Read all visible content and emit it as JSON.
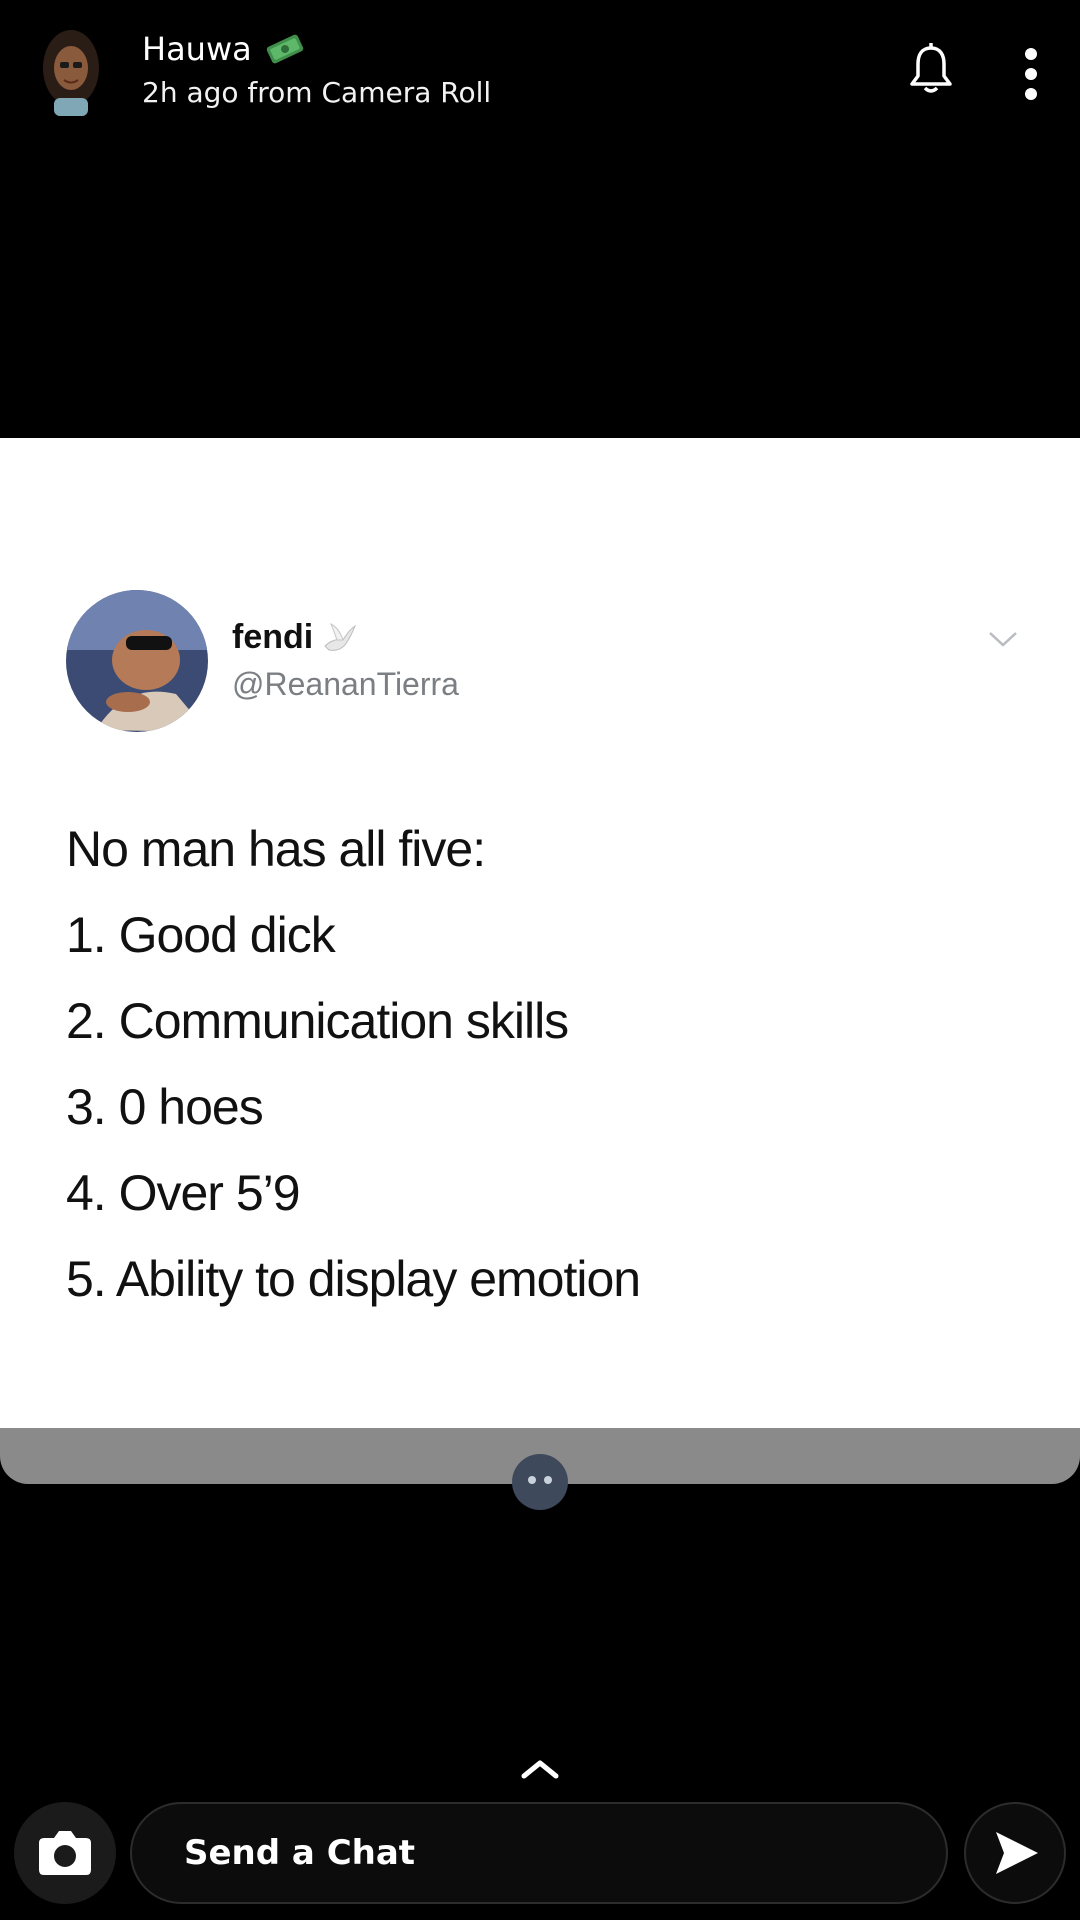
{
  "header": {
    "username": "Hauwa",
    "subtitle": "2h ago from Camera Roll",
    "icons": [
      "avatar",
      "money-icon",
      "bell-icon",
      "more-icon"
    ]
  },
  "tweet": {
    "display_name": "fendi",
    "handle": "@ReananTierra",
    "lines": [
      "No man has all five:",
      "1. Good dick",
      "2. Communication skills",
      "3. 0 hoes",
      "4. Over 5’9",
      "5. Ability to display emotion"
    ]
  },
  "composer": {
    "placeholder": "Send a Chat"
  },
  "colors": {
    "background": "#000000",
    "card": "#ffffff",
    "handle": "#7b7f83"
  }
}
